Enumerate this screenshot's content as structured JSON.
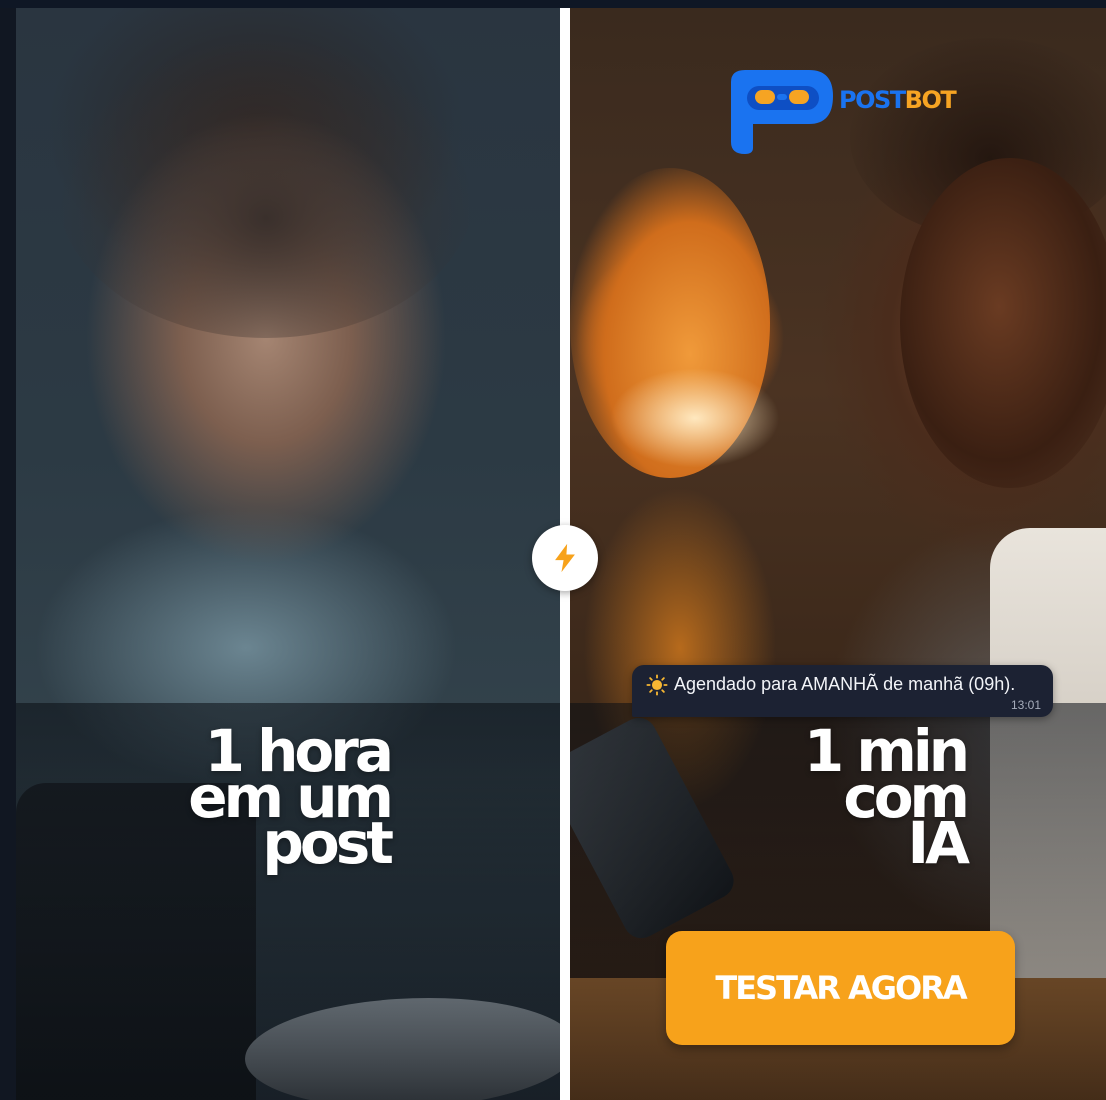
{
  "brand": {
    "name_part1": "POST",
    "name_part2": "BOT",
    "primary_color": "#1a73f0",
    "accent_color": "#f6a423",
    "logo_icon": "robot-p-logo-icon"
  },
  "left_panel": {
    "headline_lines": [
      "1 hora",
      "em um",
      "post"
    ]
  },
  "right_panel": {
    "headline_lines": [
      "1 min",
      "com",
      "IA"
    ]
  },
  "divider_badge": {
    "icon": "lightning-icon",
    "color": "#f7a21b"
  },
  "chat": {
    "icon": "sun-icon",
    "message": "Agendado para AMANHÃ de manhã (09h).",
    "time": "13:01"
  },
  "cta": {
    "label": "TESTAR AGORA",
    "color": "#f7a21b"
  }
}
